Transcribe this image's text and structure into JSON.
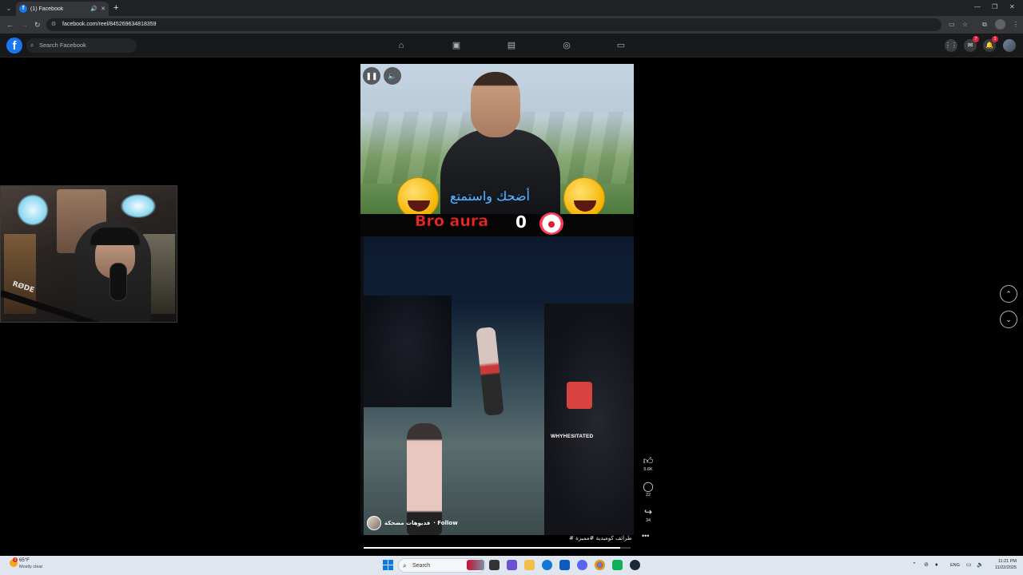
{
  "browser": {
    "tab": {
      "title": "(1) Facebook",
      "favicon": "f"
    },
    "url": "facebook.com/reel/845269634818359"
  },
  "fb": {
    "logo": "f",
    "search_placeholder": "Search Facebook",
    "notifications_count": "7",
    "messenger_count": "1",
    "nav_icons": [
      "home-icon",
      "video-icon",
      "marketplace-icon",
      "groups-icon",
      "gaming-icon"
    ]
  },
  "reel": {
    "caption_overlay_arabic": "أضحك واستمتع",
    "overlay_text": "Bro aura",
    "overlay_zero": "0",
    "watermark": "WHYHESITATED",
    "owner_name": "فديوهات مضحكة",
    "follow_label": "· Follow",
    "caption": "طرائف كوميدية #مميزة #",
    "progress_percent": 96,
    "likes": "5.6K",
    "comments": "22",
    "shares": "34"
  },
  "webcam": {
    "mic_brand": "RØDE"
  },
  "taskbar": {
    "weather_temp": "65°F",
    "weather_cond": "Mostly clear",
    "weather_badge": "3",
    "search_placeholder": "Search",
    "lang": "ENG",
    "time": "11:21 PM",
    "date": "11/22/2025"
  },
  "colors": {
    "fb_blue": "#1877f2",
    "badge_red": "#e41e3f",
    "taskbar": "#dfe6ef"
  }
}
